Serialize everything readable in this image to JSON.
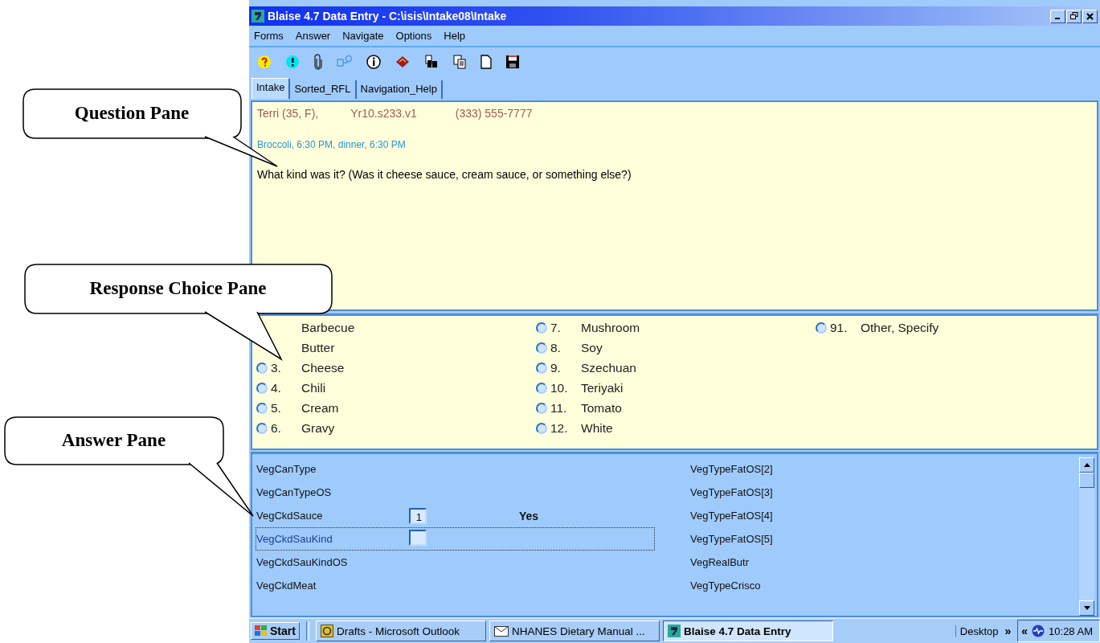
{
  "window": {
    "title": "Blaise 4.7 Data Entry - C:\\isis\\Intake08\\Intake"
  },
  "menu": [
    "Forms",
    "Answer",
    "Navigate",
    "Options",
    "Help"
  ],
  "tabs": [
    {
      "label": "Intake",
      "selected": true
    },
    {
      "label": "Sorted_RFL",
      "selected": false
    },
    {
      "label": "Navigation_Help",
      "selected": false
    }
  ],
  "question_pane": {
    "header": [
      "Terri (35, F),",
      "Yr10.s233.v1",
      "(333) 555-7777"
    ],
    "context": "Broccoli, 6:30 PM, dinner, 6:30 PM",
    "question": "What kind was it? (Was it cheese sauce, cream sauce, or something else?)"
  },
  "response_choices": [
    [
      {
        "label": "Barbecue"
      },
      {
        "label": "Butter"
      },
      {
        "number": "3.",
        "label": "Cheese",
        "selected": false
      },
      {
        "number": "4.",
        "label": "Chili",
        "selected": false
      },
      {
        "number": "5.",
        "label": "Cream",
        "selected": false
      },
      {
        "number": "6.",
        "label": "Gravy",
        "selected": false
      }
    ],
    [
      {
        "number": "7.",
        "label": "Mushroom",
        "selected": false
      },
      {
        "number": "8.",
        "label": "Soy",
        "selected": false
      },
      {
        "number": "9.",
        "label": "Szechuan",
        "selected": false
      },
      {
        "number": "10.",
        "label": "Teriyaki",
        "selected": false
      },
      {
        "number": "11.",
        "label": "Tomato",
        "selected": false
      },
      {
        "number": "12.",
        "label": "White",
        "selected": false
      }
    ],
    [
      {
        "number": "91.",
        "label": "Other, Specify",
        "selected": false
      }
    ]
  ],
  "answer_pane": {
    "left_rows": [
      {
        "name": "VegCanType",
        "kind": "plain",
        "focused": false
      },
      {
        "name": "VegCanTypeOS",
        "kind": "plain",
        "focused": false
      },
      {
        "name": "VegCkdSauce",
        "kind": "field",
        "value": "1",
        "answer": "Yes",
        "focused": false
      },
      {
        "name": "VegCkdSauKind",
        "kind": "field",
        "focused": true
      },
      {
        "name": "VegCkdSauKindOS",
        "kind": "plain",
        "focused": false
      },
      {
        "name": "VegCkdMeat",
        "kind": "plain",
        "focused": false
      }
    ],
    "right_rows": [
      "VegTypeFatOS[2]",
      "VegTypeFatOS[3]",
      "VegTypeFatOS[4]",
      "VegTypeFatOS[5]",
      "VegRealButr",
      "VegTypeCrisco"
    ]
  },
  "taskbar": {
    "start": "Start",
    "tasks": [
      {
        "label": "Drafts - Microsoft Outlook",
        "kind": "outlook",
        "selected": false
      },
      {
        "label": "NHANES Dietary Manual ...",
        "kind": "mail",
        "selected": false
      },
      {
        "label": "Blaise 4.7 Data Entry",
        "kind": "blaise",
        "selected": true
      }
    ],
    "tray": {
      "desktop": "Desktop",
      "chevron": "»",
      "back": "«",
      "time": "10:28 AM"
    }
  },
  "callouts": [
    {
      "text": "Question Pane"
    },
    {
      "text": "Response Choice Pane"
    },
    {
      "text": "Answer Pane"
    }
  ]
}
